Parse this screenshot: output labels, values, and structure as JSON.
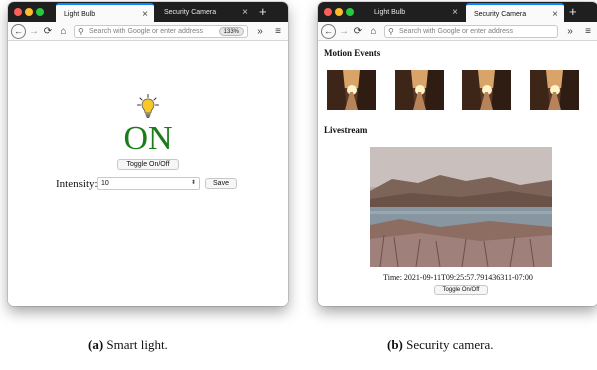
{
  "window_a": {
    "tabs": [
      {
        "label": "Light Bulb",
        "active": true
      },
      {
        "label": "Security Camera",
        "active": false
      }
    ],
    "url_placeholder": "Search with Google or enter address",
    "zoom": "133%",
    "status_text": "ON",
    "toggle_label": "Toggle On/Off",
    "intensity_label": "Intensity:",
    "intensity_value": "10",
    "save_label": "Save",
    "bulb_icon": "lightbulb-icon",
    "status_color": "#1a7d1a"
  },
  "window_b": {
    "tabs": [
      {
        "label": "Light Bulb",
        "active": false
      },
      {
        "label": "Security Camera",
        "active": true
      }
    ],
    "url_placeholder": "Search with Google or enter address",
    "motion_heading": "Motion Events",
    "motion_event_count": 4,
    "livestream_heading": "Livestream",
    "time_text": "Time: 2021-09-11T09:25:57.791436311-07:00",
    "toggle_label": "Toggle On/Off"
  },
  "captions": {
    "a_label": "(a)",
    "a_text": "Smart light.",
    "b_label": "(b)",
    "b_text": "Security camera."
  },
  "colors": {
    "tabbar": "#1f1f1f",
    "active_tab_accent": "#0a84ff",
    "close_dot": "#fe5f57",
    "minimize_dot": "#febc2e",
    "zoom_dot": "#28c840"
  }
}
